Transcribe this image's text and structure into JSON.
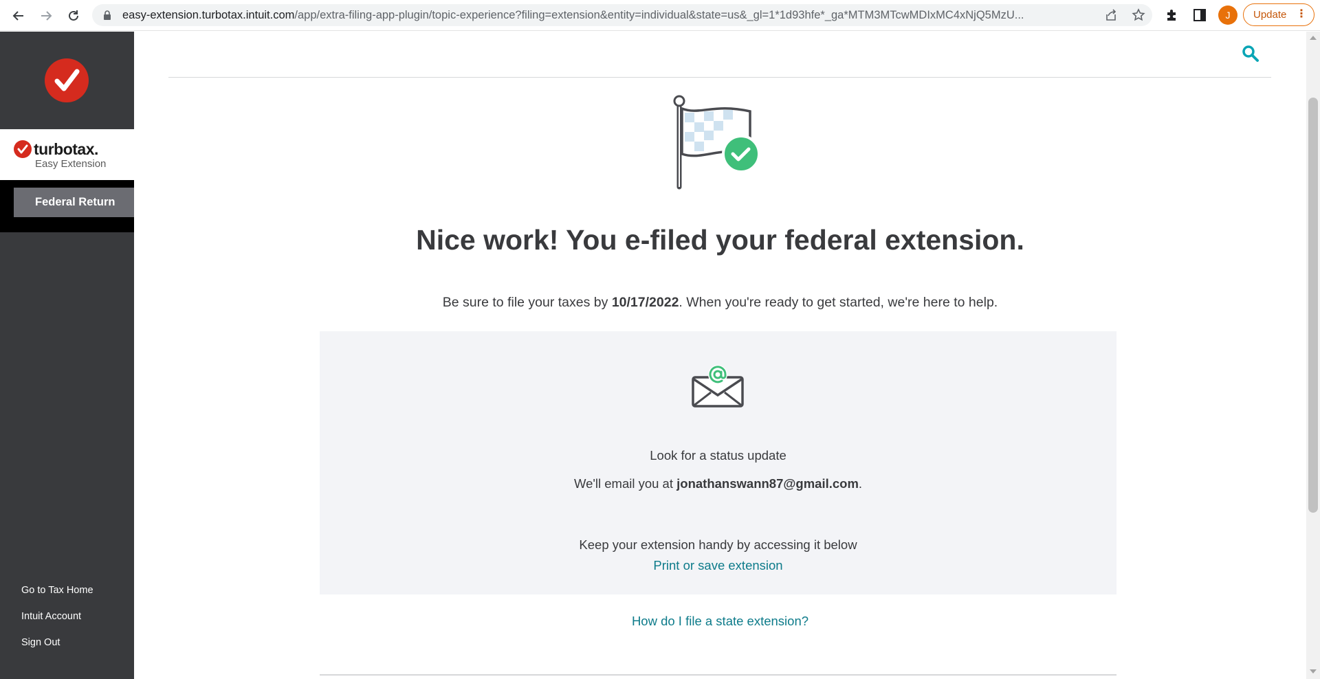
{
  "browser": {
    "url_host": "easy-extension.turbotax.intuit.com",
    "url_path": "/app/extra-filing-app-plugin/topic-experience?filing=extension&entity=individual&state=us&_gl=1*1d93hfe*_ga*MTM3MTcwMDIxMC4xNjQ5MzU...",
    "avatar_initial": "J",
    "update_label": "Update",
    "menu_dots": "⋮"
  },
  "sidebar": {
    "brand_name": "turbotax.",
    "brand_subtitle": "Easy Extension",
    "federal_return_label": "Federal Return",
    "links": [
      "Go to Tax Home",
      "Intuit Account",
      "Sign Out"
    ]
  },
  "main": {
    "headline": "Nice work! You e-filed your federal extension.",
    "sub_before": "Be sure to file your taxes by ",
    "sub_date": "10/17/2022",
    "sub_after": ". When you're ready to get started, we're here to help.",
    "panel": {
      "title": "Look for a status update",
      "email_before": "We'll email you at ",
      "email_address": "jonathanswann87@gmail.com",
      "email_after": ".",
      "keep_text": "Keep your extension handy by accessing it below",
      "print_link": "Print or save extension"
    },
    "state_link": "How do I file a state extension?"
  },
  "colors": {
    "brand_red": "#d52b1e",
    "link_teal": "#0d7b8a",
    "sidebar_dark": "#393a3d",
    "success_green": "#3fbf7a",
    "update_orange": "#e8710a"
  },
  "icons": {
    "back": "arrow-left-icon",
    "forward": "arrow-right-icon",
    "reload": "reload-icon",
    "lock": "lock-icon",
    "share": "share-icon",
    "bookmark": "star-icon",
    "extensions": "puzzle-icon",
    "sidepanel": "sidepanel-icon",
    "search": "search-icon",
    "flag": "checkered-flag-icon",
    "email": "envelope-at-icon"
  }
}
